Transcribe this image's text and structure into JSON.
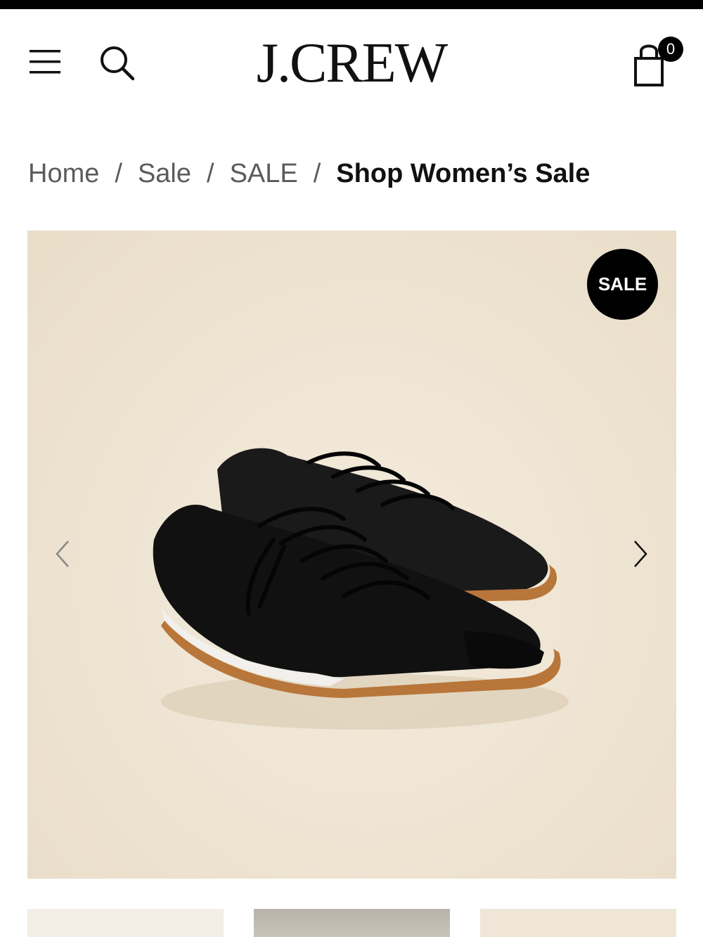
{
  "header": {
    "logo_text": "J.CREW",
    "menu_icon": "hamburger-menu-icon",
    "search_icon": "search-icon",
    "bag_icon": "shopping-bag-icon",
    "bag_count": "0"
  },
  "breadcrumb": {
    "items": [
      "Home",
      "Sale",
      "SALE"
    ],
    "separator": "/",
    "current": "Shop Women’s Sale"
  },
  "product_gallery": {
    "badge": "SALE",
    "prev_icon": "chevron-left-icon",
    "next_icon": "chevron-right-icon",
    "image_subject": "shoe-image",
    "background_color": "#efe5d4"
  },
  "colors": {
    "brand": "#000000",
    "breadcrumb_link": "#5b5b5b",
    "breadcrumb_current": "#111111"
  }
}
